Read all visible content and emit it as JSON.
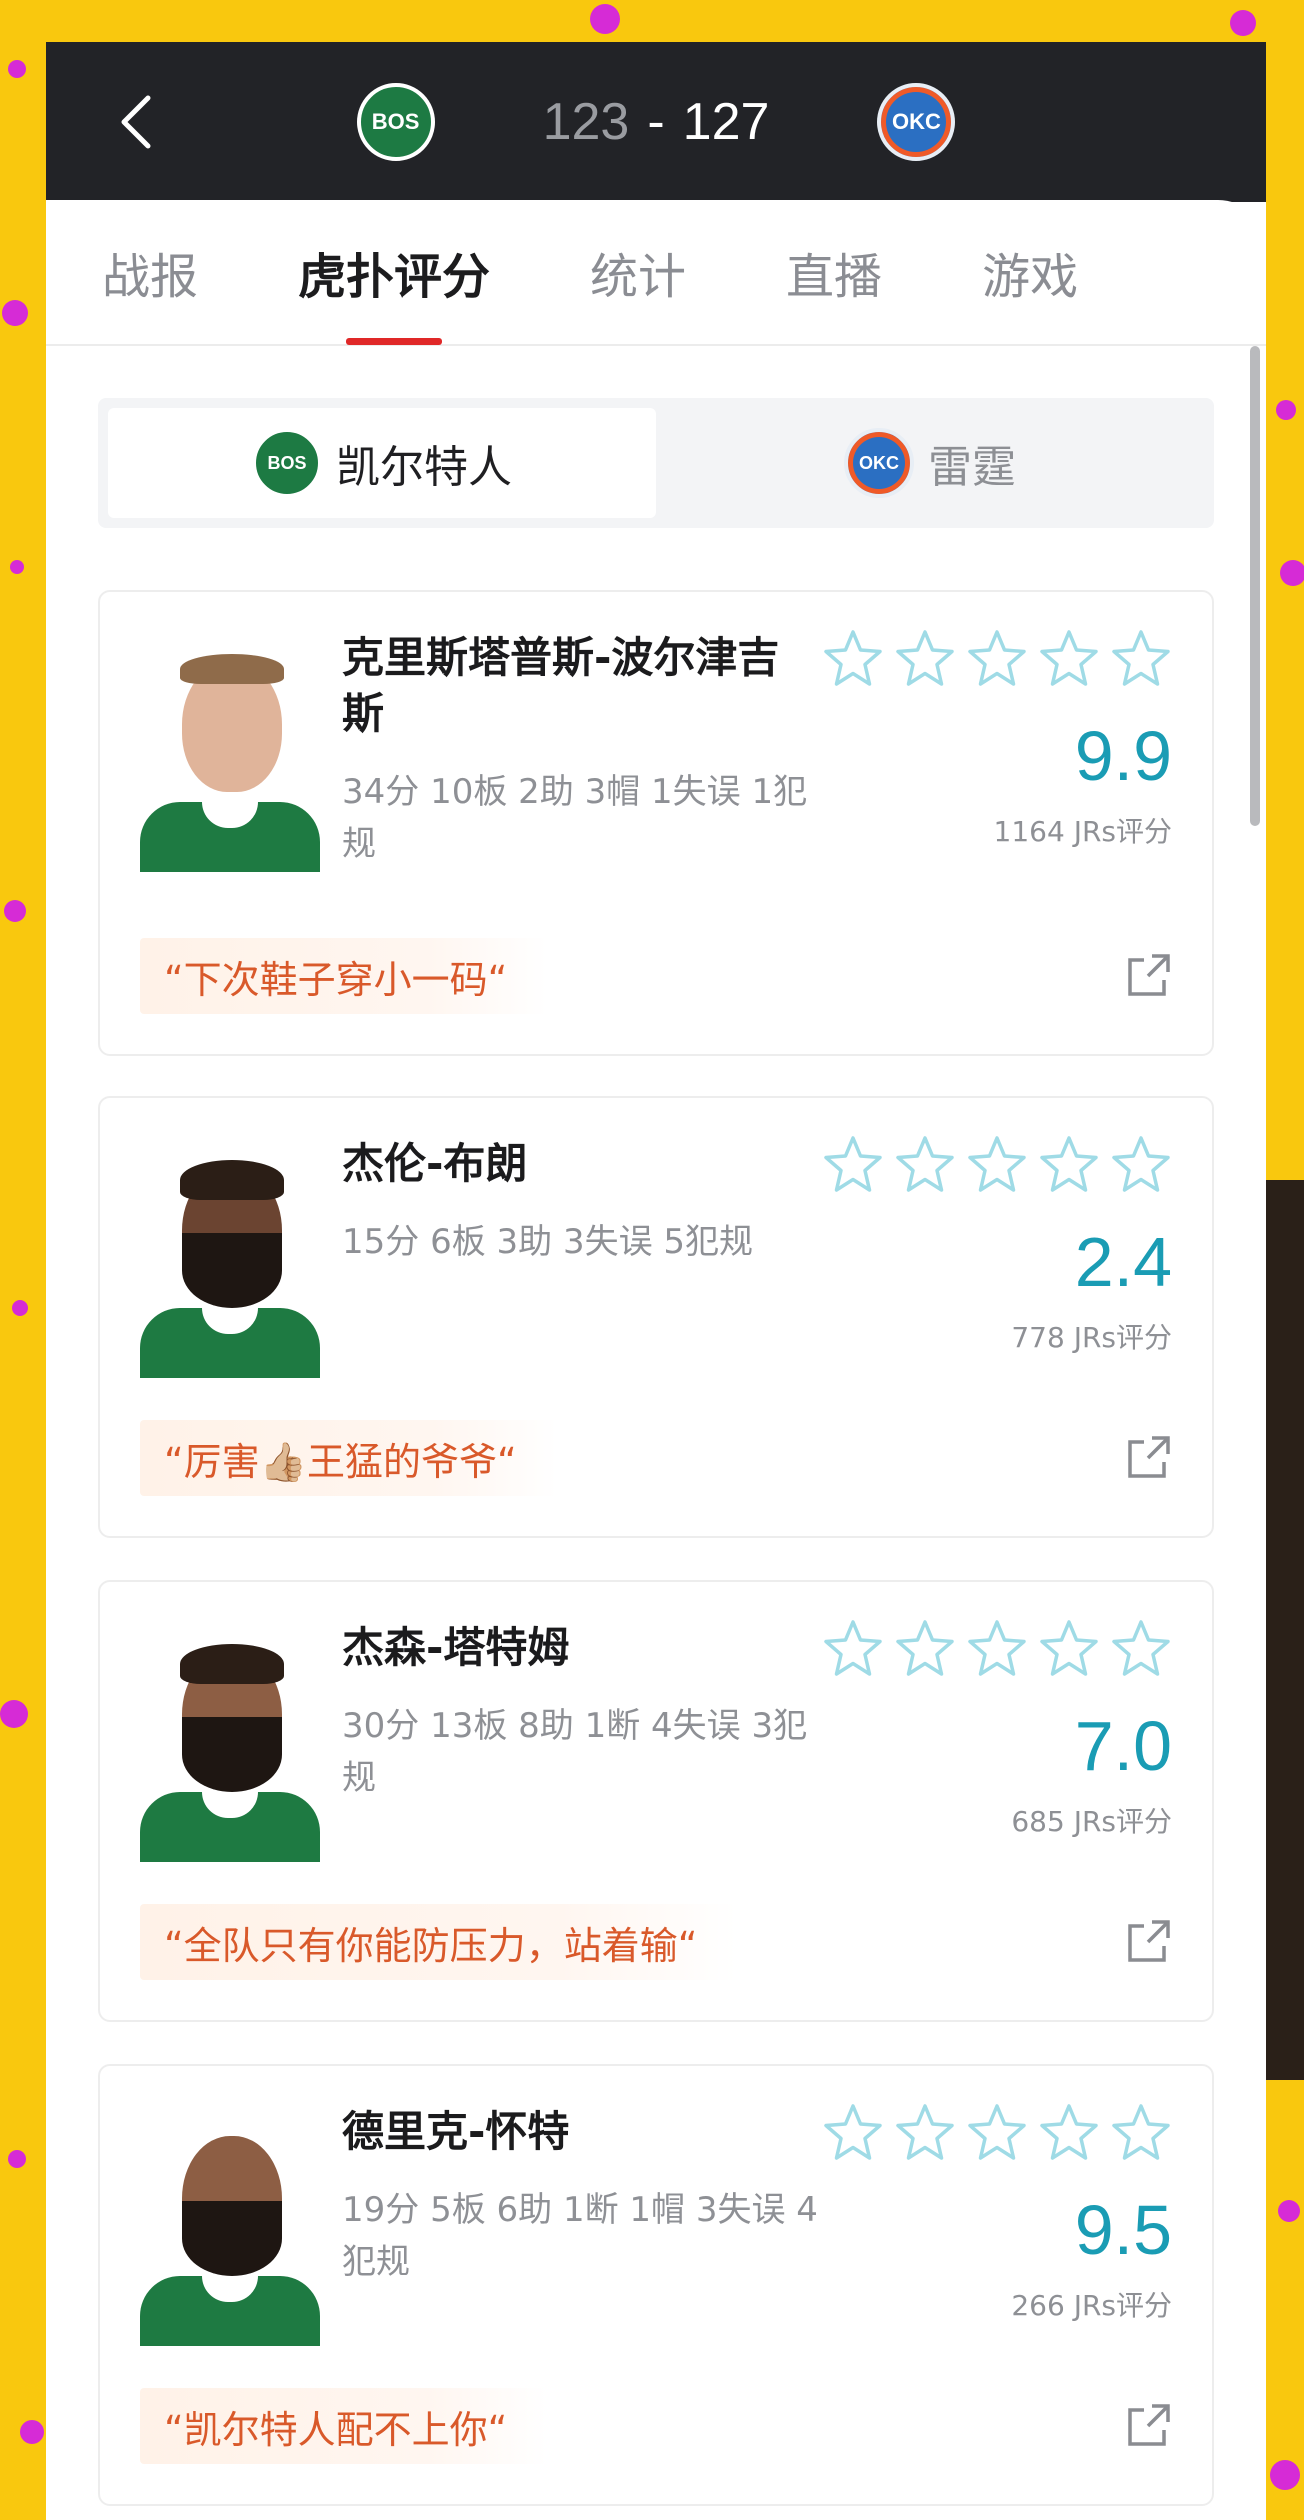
{
  "header": {
    "home_team_logo": "BOS",
    "away_team_logo": "OKC",
    "home_score": "123",
    "separator": "-",
    "away_score": "127",
    "back_icon": "chevron-left-icon"
  },
  "tabs": [
    {
      "label": "战报",
      "active": false
    },
    {
      "label": "虎扑评分",
      "active": true
    },
    {
      "label": "统计",
      "active": false
    },
    {
      "label": "直播",
      "active": false
    },
    {
      "label": "游戏",
      "active": false
    }
  ],
  "team_switch": {
    "home": {
      "logo": "BOS",
      "label": "凯尔特人",
      "active": true
    },
    "away": {
      "logo": "OKC",
      "label": "雷霆",
      "active": false
    }
  },
  "players": [
    {
      "name": "克里斯塔普斯-波尔津吉斯",
      "stats": "34分 10板 2助 3帽 1失误 1犯规",
      "rating": "9.9",
      "votes": "1164 JRs评分",
      "comment": "“下次鞋子穿小一码“",
      "stars": 5
    },
    {
      "name": "杰伦-布朗",
      "stats": "15分 6板 3助 3失误 5犯规",
      "rating": "2.4",
      "votes": "778 JRs评分",
      "comment": "“厉害👍🏼王猛的爷爷“",
      "stars": 5
    },
    {
      "name": "杰森-塔特姆",
      "stats": "30分 13板 8助 1断 4失误 3犯规",
      "rating": "7.0",
      "votes": "685 JRs评分",
      "comment": "“全队只有你能防压力，站着输“",
      "stars": 5
    },
    {
      "name": "德里克-怀特",
      "stats": "19分 5板 6助 1断 1帽 3失误 4犯规",
      "rating": "9.5",
      "votes": "266 JRs评分",
      "comment": "“凯尔特人配不上你“",
      "stars": 5
    }
  ],
  "colors": {
    "accent_rating": "#1a9cb4",
    "tab_indicator": "#e02828",
    "comment_text": "#d9592a",
    "star_outline": "#9fdbe6"
  }
}
